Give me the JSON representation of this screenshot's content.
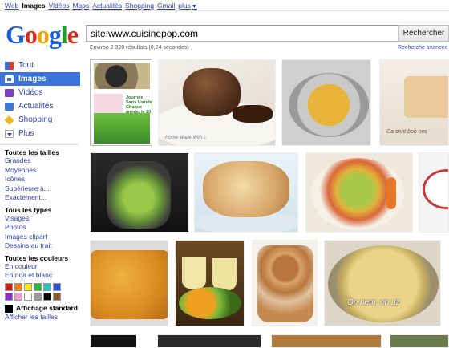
{
  "topnav": {
    "items": [
      "Web",
      "Images",
      "Vidéos",
      "Maps",
      "Actualités",
      "Shopping",
      "Gmail",
      "plus"
    ],
    "active_index": 1,
    "more_caret": "▼"
  },
  "logo": {
    "letters": [
      "G",
      "o",
      "o",
      "g",
      "l",
      "e"
    ]
  },
  "search": {
    "query": "site:www.cuisinepop.com",
    "button_label": "Rechercher",
    "stats": "Environ 2 320 résultats (0,24 secondes)",
    "advanced_link": "Recherche avancée"
  },
  "sidebar": {
    "nav": [
      {
        "label": "Tout",
        "icon": "everything-icon"
      },
      {
        "label": "Images",
        "icon": "images-icon",
        "active": true
      },
      {
        "label": "Vidéos",
        "icon": "videos-icon"
      },
      {
        "label": "Actualités",
        "icon": "news-icon"
      },
      {
        "label": "Shopping",
        "icon": "shopping-tag-icon"
      },
      {
        "label": "Plus",
        "icon": "more-dropdown-icon"
      }
    ],
    "sizes": {
      "heading": "Toutes les tailles",
      "options": [
        "Grandes",
        "Moyennes",
        "Icônes",
        "Supérieure à...",
        "Exactement..."
      ]
    },
    "types": {
      "heading": "Tous les types",
      "options": [
        "Visages",
        "Photos",
        "Images clipart",
        "Dessins au trait"
      ]
    },
    "colors": {
      "heading": "Toutes les couleurs",
      "options": [
        "En couleur",
        "En noir et blanc"
      ],
      "swatches": [
        "#cc1b1b",
        "#f07f12",
        "#f5e61f",
        "#36b43a",
        "#2ec3c3",
        "#2a4fd1",
        "#8a2ecf",
        "#f29ad1",
        "#ffffff",
        "#999999",
        "#000000",
        "#8b5a2b"
      ]
    },
    "display": {
      "label": "Affichage standard",
      "sizes_link": "Afficher les tailles"
    }
  },
  "poster_text": "Journée Sans Viande\nChaque année, le 20 mars",
  "watermarks": {
    "t2": "Home Made With L",
    "t4": "Ca sent bon ces",
    "t12": "On nem, on riz"
  }
}
